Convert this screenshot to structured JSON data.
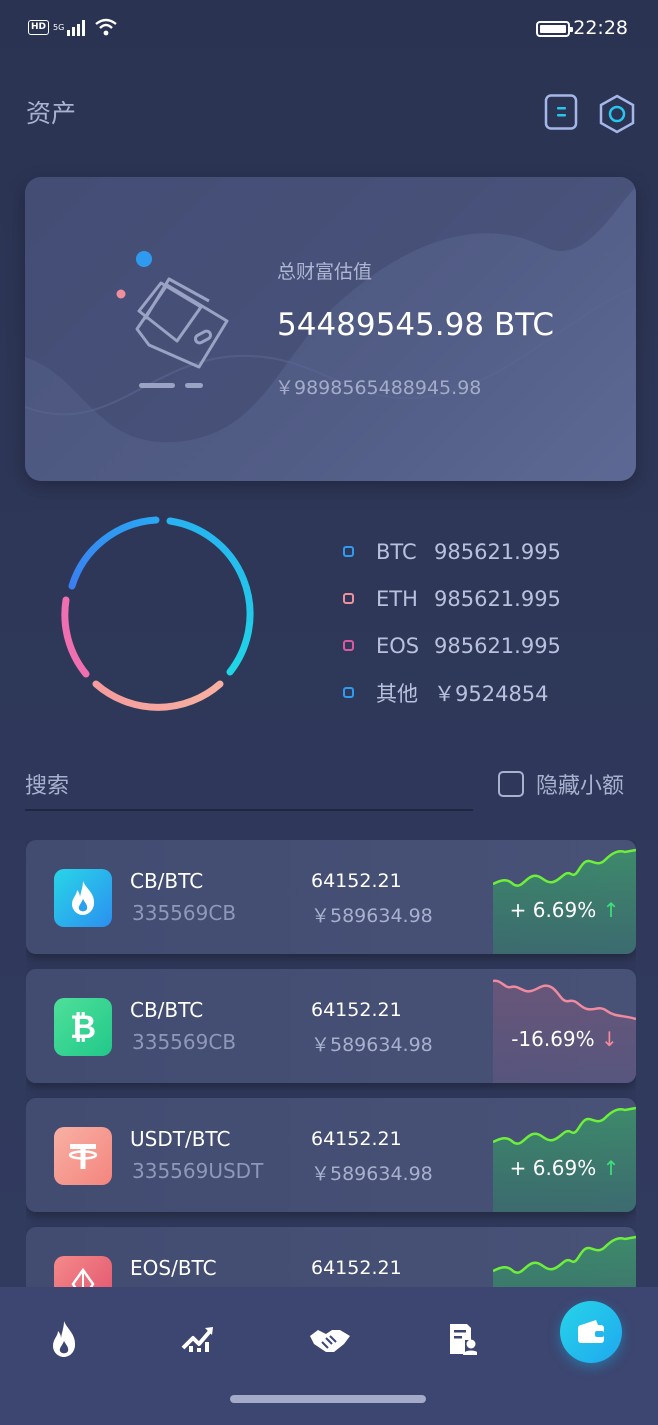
{
  "status_bar": {
    "hd": "HD",
    "network": "5G",
    "time": "22:28"
  },
  "header": {
    "title": "资产"
  },
  "total": {
    "label": "总财富估值",
    "btc_value": "54489545.98 BTC",
    "cny_value": "￥9898565488945.98"
  },
  "distribution": {
    "items": [
      {
        "name": "BTC",
        "value": "985621.995",
        "color": "#2f9bf0"
      },
      {
        "name": "ETH",
        "value": "985621.995",
        "color": "#f0909c"
      },
      {
        "name": "EOS",
        "value": "985621.995",
        "color": "#d85aa0"
      },
      {
        "name": "其他",
        "value": "￥9524854",
        "color": "#2f9bf0"
      }
    ]
  },
  "filter": {
    "search_label": "搜索",
    "hide_small_label": "隐藏小额",
    "hide_small_checked": false
  },
  "assets": [
    {
      "pair": "CB/BTC",
      "amount": "335569CB",
      "price": "64152.21",
      "price_cny": "￥589634.98",
      "change": "+ 6.69%",
      "direction": "up",
      "arrow": "↑",
      "icon": "flame-icon"
    },
    {
      "pair": "CB/BTC",
      "amount": "335569CB",
      "price": "64152.21",
      "price_cny": "￥589634.98",
      "change": "-16.69%",
      "direction": "down",
      "arrow": "↓",
      "icon": "bitcoin-icon"
    },
    {
      "pair": "USDT/BTC",
      "amount": "335569USDT",
      "price": "64152.21",
      "price_cny": "￥589634.98",
      "change": "+ 6.69%",
      "direction": "up",
      "arrow": "↑",
      "icon": "tether-icon"
    },
    {
      "pair": "EOS/BTC",
      "amount": "",
      "price": "64152.21",
      "price_cny": "",
      "change": "",
      "direction": "up",
      "arrow": "",
      "icon": "eos-icon"
    }
  ],
  "bottom_nav": {
    "items": [
      "flame-icon",
      "chart-up-icon",
      "handshake-icon",
      "report-icon",
      "wallet-icon"
    ],
    "active": "wallet-icon"
  },
  "colors": {
    "up": "#3fe07a",
    "down": "#f58a9a",
    "accent": "#27c6ee"
  }
}
